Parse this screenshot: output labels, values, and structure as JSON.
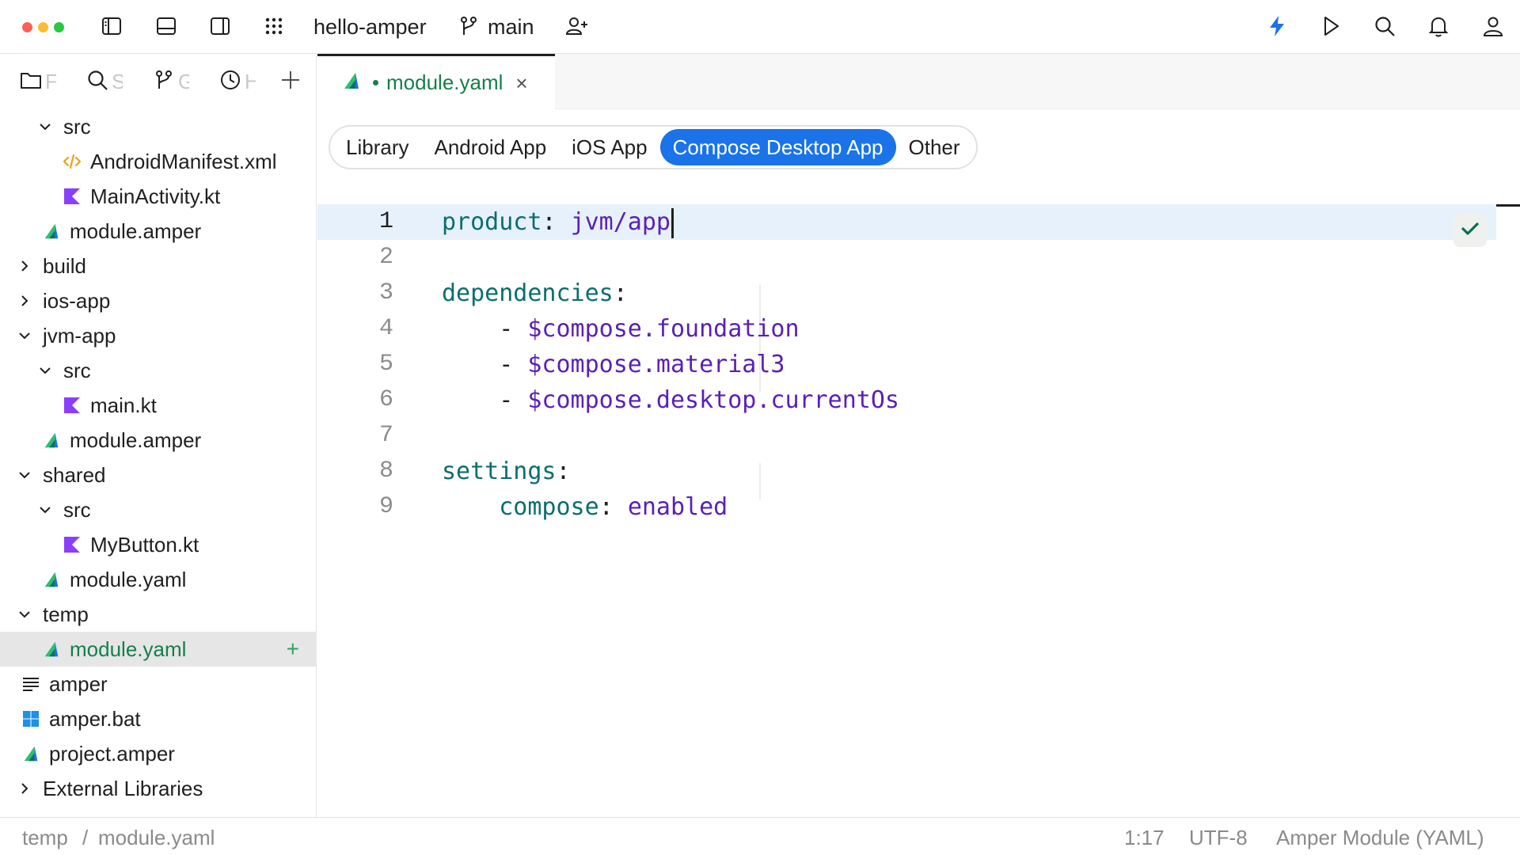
{
  "window": {
    "project_name": "hello-amper",
    "branch_name": "main"
  },
  "colors": {
    "accent": "#1a73e8",
    "modified_green": "#14804a",
    "yaml_key": "#0b6e6e",
    "yaml_value": "#5a1fb5",
    "kotlin": "#8a3ffc",
    "xml": "#e8a317"
  },
  "sidebar": {
    "tabs": [
      {
        "icon": "folder-icon",
        "label": "F"
      },
      {
        "icon": "search-icon",
        "label": "S"
      },
      {
        "icon": "branch-icon",
        "label": "G"
      },
      {
        "icon": "clock-icon",
        "label": "H"
      }
    ],
    "tree": [
      {
        "label": "src",
        "indent": 1,
        "type": "folder",
        "expanded": true
      },
      {
        "label": "AndroidManifest.xml",
        "indent": 2,
        "type": "xml"
      },
      {
        "label": "MainActivity.kt",
        "indent": 2,
        "type": "kotlin"
      },
      {
        "label": "module.amper",
        "indent": 1,
        "type": "amper"
      },
      {
        "label": "build",
        "indent": 0,
        "type": "folder",
        "expanded": false
      },
      {
        "label": "ios-app",
        "indent": 0,
        "type": "folder",
        "expanded": false
      },
      {
        "label": "jvm-app",
        "indent": 0,
        "type": "folder",
        "expanded": true
      },
      {
        "label": "src",
        "indent": 1,
        "type": "folder",
        "expanded": true
      },
      {
        "label": "main.kt",
        "indent": 2,
        "type": "kotlin"
      },
      {
        "label": "module.amper",
        "indent": 1,
        "type": "amper"
      },
      {
        "label": "shared",
        "indent": 0,
        "type": "folder",
        "expanded": true
      },
      {
        "label": "src",
        "indent": 1,
        "type": "folder",
        "expanded": true
      },
      {
        "label": "MyButton.kt",
        "indent": 2,
        "type": "kotlin"
      },
      {
        "label": "module.yaml",
        "indent": 1,
        "type": "amper"
      },
      {
        "label": "temp",
        "indent": 0,
        "type": "folder",
        "expanded": true
      },
      {
        "label": "module.yaml",
        "indent": 1,
        "type": "amper",
        "selected": true,
        "added": true
      },
      {
        "label": "amper",
        "indent": 0,
        "type": "text"
      },
      {
        "label": "amper.bat",
        "indent": 0,
        "type": "windows"
      },
      {
        "label": "project.amper",
        "indent": 0,
        "type": "amper"
      },
      {
        "label": "External Libraries",
        "indent": 0,
        "type": "folder",
        "expanded": false
      }
    ]
  },
  "editor": {
    "tab": {
      "name": "module.yaml",
      "modified": true,
      "close_glyph": "×"
    },
    "templates": [
      {
        "label": "Library",
        "active": false
      },
      {
        "label": "Android App",
        "active": false
      },
      {
        "label": "iOS App",
        "active": false
      },
      {
        "label": "Compose Desktop App",
        "active": true
      },
      {
        "label": "Other",
        "active": false
      }
    ],
    "lines": [
      {
        "num": "1",
        "key": "product",
        "sep": ": ",
        "value": "jvm/app",
        "current": true
      },
      {
        "num": "2"
      },
      {
        "num": "3",
        "key": "dependencies",
        "sep": ":"
      },
      {
        "num": "4",
        "indent": "    ",
        "dash": "- ",
        "value": "$compose.foundation"
      },
      {
        "num": "5",
        "indent": "    ",
        "dash": "- ",
        "value": "$compose.material3"
      },
      {
        "num": "6",
        "indent": "    ",
        "dash": "- ",
        "value": "$compose.desktop.currentOs"
      },
      {
        "num": "7"
      },
      {
        "num": "8",
        "key": "settings",
        "sep": ":"
      },
      {
        "num": "9",
        "indent": "    ",
        "key": "compose",
        "sep": ": ",
        "value": "enabled"
      }
    ]
  },
  "statusbar": {
    "breadcrumb": [
      "temp",
      "module.yaml"
    ],
    "breadcrumb_sep": "/",
    "position": "1:17",
    "encoding": "UTF-8",
    "file_type": "Amper Module (YAML)"
  }
}
